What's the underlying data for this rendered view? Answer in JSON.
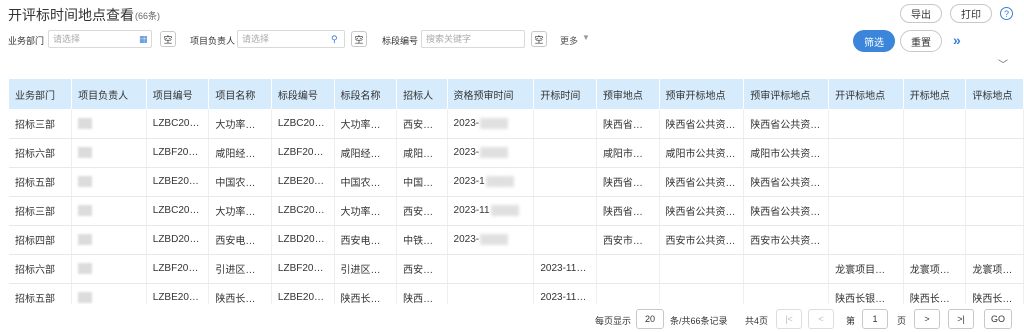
{
  "header": {
    "title": "开评标时间地点查看",
    "count": "(66条)",
    "export_label": "导出",
    "print_label": "打印",
    "help_glyph": "?"
  },
  "filters": {
    "dept_label": "业务部门",
    "dept_placeholder": "请选择",
    "owner_label": "项目负责人",
    "owner_placeholder": "请选择",
    "section_label": "标段编号",
    "section_placeholder": "搜索关键字",
    "empty_label": "空",
    "more_label": "更多",
    "filter_label": "筛选",
    "reset_label": "重置"
  },
  "table": {
    "columns": [
      "业务部门",
      "项目负责人",
      "项目编号",
      "项目名称",
      "标段编号",
      "标段名称",
      "招标人",
      "资格预审时间",
      "开标时间",
      "预审地点",
      "预审开标地点",
      "预审评标地点",
      "开评标地点",
      "开标地点",
      "评标地点"
    ],
    "rows": [
      [
        "招标三部",
        "",
        "LZBC20…",
        "大功率…",
        "LZBC20…",
        "大功率…",
        "西安…",
        "2023-",
        "",
        "陕西省…",
        "陕西省公共资…",
        "陕西省公共资…",
        "",
        "",
        ""
      ],
      [
        "招标六部",
        "",
        "LZBF20…",
        "咸阳经…",
        "LZBF20…",
        "咸阳经…",
        "咸阳…",
        "2023-",
        "",
        "咸阳市…",
        "咸阳市公共资…",
        "咸阳市公共资…",
        "",
        "",
        ""
      ],
      [
        "招标五部",
        "",
        "LZBE20…",
        "中国农…",
        "LZBE20…",
        "中国农…",
        "中国…",
        "2023-1",
        "",
        "陕西省…",
        "陕西省公共资…",
        "陕西省公共资…",
        "",
        "",
        ""
      ],
      [
        "招标三部",
        "",
        "LZBC20…",
        "大功率…",
        "LZBC20…",
        "大功率…",
        "西安…",
        "2023-11",
        "",
        "陕西省…",
        "陕西省公共资…",
        "陕西省公共资…",
        "",
        "",
        ""
      ],
      [
        "招标四部",
        "",
        "LZBD20…",
        "西安电…",
        "LZBD20…",
        "西安电…",
        "中铁…",
        "2023-",
        "",
        "西安市…",
        "西安市公共资…",
        "西安市公共资…",
        "",
        "",
        ""
      ],
      [
        "招标六部",
        "",
        "LZBF20…",
        "引进区…",
        "LZBF20…",
        "引进区…",
        "西安…",
        "",
        "2023-11…",
        "",
        "",
        "",
        "龙寰项目…",
        "龙寰项…",
        "龙寰项…"
      ],
      [
        "招标五部",
        "",
        "LZBE20…",
        "陕西长…",
        "LZBE20…",
        "陕西长…",
        "陕西…",
        "",
        "2023-11…",
        "",
        "",
        "",
        "陕西长银…",
        "陕西长…",
        "陕西长…"
      ]
    ]
  },
  "pager": {
    "per_page_label": "每页显示",
    "per_page_value": "20",
    "records_label": "条/共66条记录",
    "pages_label": "共4页",
    "first_glyph": "|<",
    "prev_glyph": "<",
    "page_prefix": "第",
    "page_value": "1",
    "page_suffix": "页",
    "next_glyph": ">",
    "last_glyph": ">|",
    "go_label": "GO"
  },
  "icons": {
    "calendar": "calendar-icon",
    "person": "person-icon",
    "expand": "double-chevron-right-icon",
    "collapse": "chevron-down-icon"
  },
  "colors": {
    "primary": "#3b86db",
    "header_bg": "#d6ebfb",
    "accent_icon": "#3a7fd6"
  }
}
